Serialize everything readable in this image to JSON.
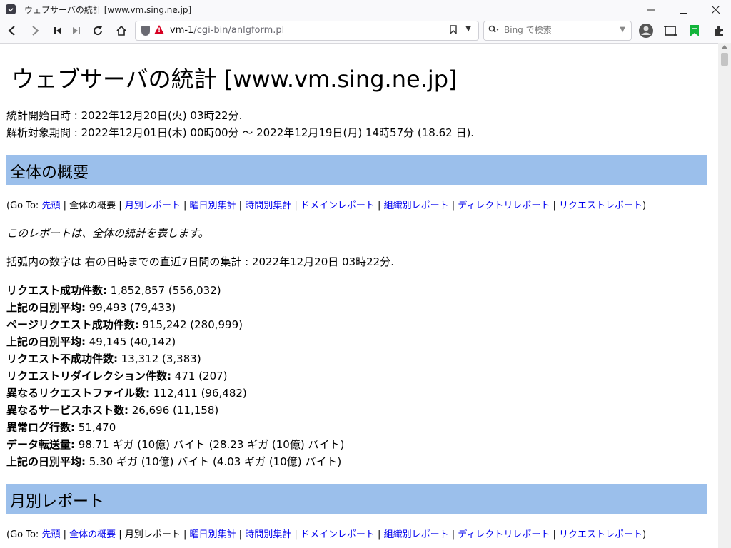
{
  "window": {
    "title": "ウェブサーバの統計 [www.vm.sing.ne.jp]",
    "minimize": "—",
    "maximize": "☐",
    "close": "✕"
  },
  "nav": {
    "url_host": "vm-1",
    "url_path": "/cgi-bin/anlgform.pl",
    "search_placeholder": "Bing で検索"
  },
  "page": {
    "title": "ウェブサーバの統計 [www.vm.sing.ne.jp]",
    "start_line": "統計開始日時 : 2022年12月20日(火) 03時22分.",
    "period_line": "解析対象期間 : 2022年12月01日(木) 00時00分 〜 2022年12月19日(月) 14時57分 (18.62 日).",
    "sections": [
      {
        "heading": "全体の概要",
        "goto_prefix": "(Go To:",
        "goto_suffix": ")",
        "goto_items": [
          {
            "label": "先頭",
            "link": true
          },
          {
            "label": "全体の概要",
            "link": false
          },
          {
            "label": "月別レポート",
            "link": true
          },
          {
            "label": "曜日別集計",
            "link": true
          },
          {
            "label": "時間別集計",
            "link": true
          },
          {
            "label": "ドメインレポート",
            "link": true
          },
          {
            "label": "組織別レポート",
            "link": true
          },
          {
            "label": "ディレクトリレポート",
            "link": true
          },
          {
            "label": "リクエストレポート",
            "link": true
          }
        ]
      },
      {
        "heading": "月別レポート",
        "goto_prefix": "(Go To:",
        "goto_suffix": ")",
        "goto_items": [
          {
            "label": "先頭",
            "link": true
          },
          {
            "label": "全体の概要",
            "link": true
          },
          {
            "label": "月別レポート",
            "link": false
          },
          {
            "label": "曜日別集計",
            "link": true
          },
          {
            "label": "時間別集計",
            "link": true
          },
          {
            "label": "ドメインレポート",
            "link": true
          },
          {
            "label": "組織別レポート",
            "link": true
          },
          {
            "label": "ディレクトリレポート",
            "link": true
          },
          {
            "label": "リクエストレポート",
            "link": true
          }
        ]
      }
    ],
    "summary_note": "このレポートは、全体の統計を表します。",
    "recent_note": "括弧内の数字は 右の日時までの直近7日間の集計 : 2022年12月20日 03時22分.",
    "stats": [
      {
        "label": "リクエスト成功件数:",
        "value": " 1,852,857 (556,032)"
      },
      {
        "label": "上記の日別平均:",
        "value": " 99,493 (79,433)"
      },
      {
        "label": "ページリクエスト成功件数:",
        "value": " 915,242 (280,999)"
      },
      {
        "label": "上記の日別平均:",
        "value": " 49,145 (40,142)"
      },
      {
        "label": "リクエスト不成功件数:",
        "value": " 13,312 (3,383)"
      },
      {
        "label": "リクエストリダイレクション件数:",
        "value": " 471 (207)"
      },
      {
        "label": "異なるリクエストファイル数:",
        "value": " 112,411 (96,482)"
      },
      {
        "label": "異なるサービスホスト数:",
        "value": " 26,696 (11,158)"
      },
      {
        "label": "異常ログ行数:",
        "value": " 51,470"
      },
      {
        "label": "データ転送量:",
        "value": " 98.71 ギガ (10億) バイト (28.23 ギガ (10億) バイト)"
      },
      {
        "label": "上記の日別平均:",
        "value": " 5.30 ギガ (10億) バイト (4.03 ギガ (10億) バイト)"
      }
    ]
  }
}
